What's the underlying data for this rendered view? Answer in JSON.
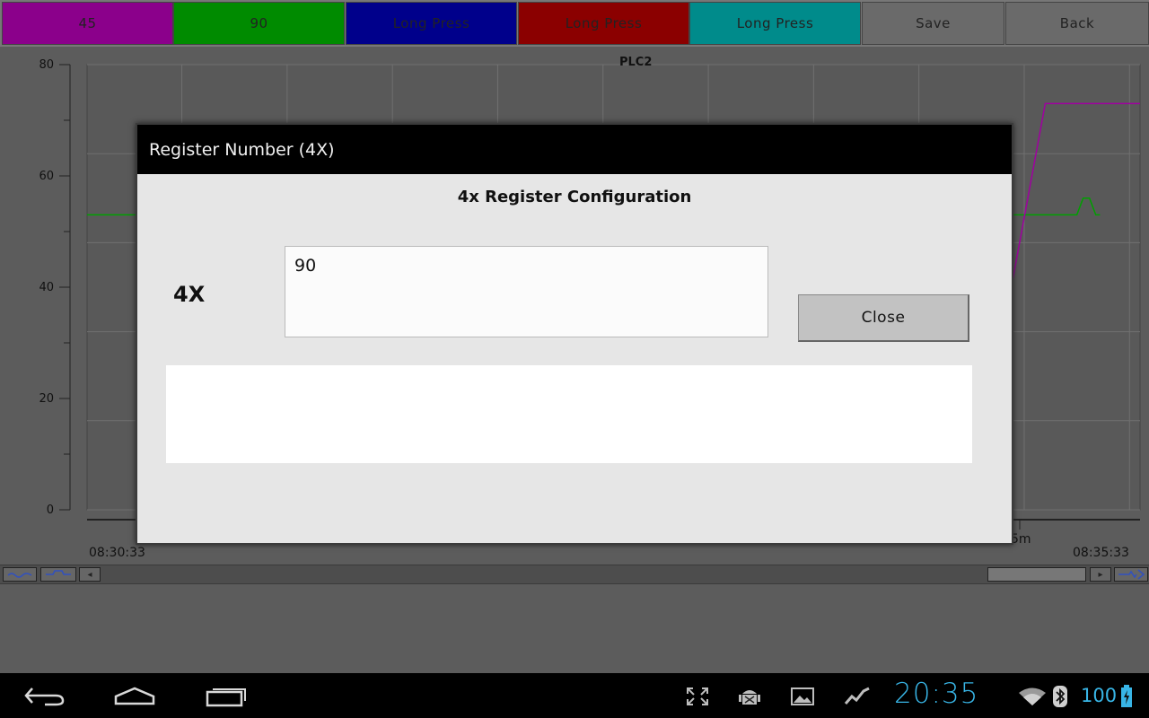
{
  "toolbar": {
    "buttons": [
      {
        "label": "45",
        "color": "#8b008b"
      },
      {
        "label": "90",
        "color": "#008b00"
      },
      {
        "label": "Long Press",
        "color": "#00008b"
      },
      {
        "label": "Long Press",
        "color": "#8b0000"
      },
      {
        "label": "Long Press",
        "color": "#008b8b"
      }
    ],
    "save_label": "Save",
    "back_label": "Back"
  },
  "chart": {
    "title": "PLC2",
    "y_ticks": [
      "80",
      "60",
      "40",
      "20",
      "0"
    ],
    "x_start": "08:30:33",
    "x_end": "08:35:33",
    "x_partial": "5m"
  },
  "chart_data": {
    "type": "line",
    "title": "PLC2",
    "ylim": [
      0,
      80
    ],
    "x_range": [
      "08:30:33",
      "08:35:33"
    ],
    "grid": true,
    "series": [
      {
        "color": "#00a000",
        "x": [
          0.0,
          0.94,
          0.946,
          0.952,
          0.958,
          0.962
        ],
        "values": [
          53,
          53,
          56,
          56,
          53,
          53
        ]
      },
      {
        "color": "#a000a0",
        "x": [
          0.87,
          0.91,
          1.0
        ],
        "values": [
          32,
          73,
          73
        ]
      }
    ]
  },
  "dialog": {
    "title": "Register Number (4X)",
    "subtitle": "4x Register Configuration",
    "field_label": "4X",
    "field_value": "90",
    "close_label": "Close",
    "message": ""
  },
  "statusbar": {
    "time": "20:35",
    "battery": "100"
  },
  "icons": [
    "back-icon",
    "home-icon",
    "recent-apps-icon",
    "fullscreen-icon",
    "android-debug-icon",
    "gallery-icon",
    "activity-icon",
    "wifi-icon",
    "bluetooth-icon",
    "battery-icon"
  ]
}
